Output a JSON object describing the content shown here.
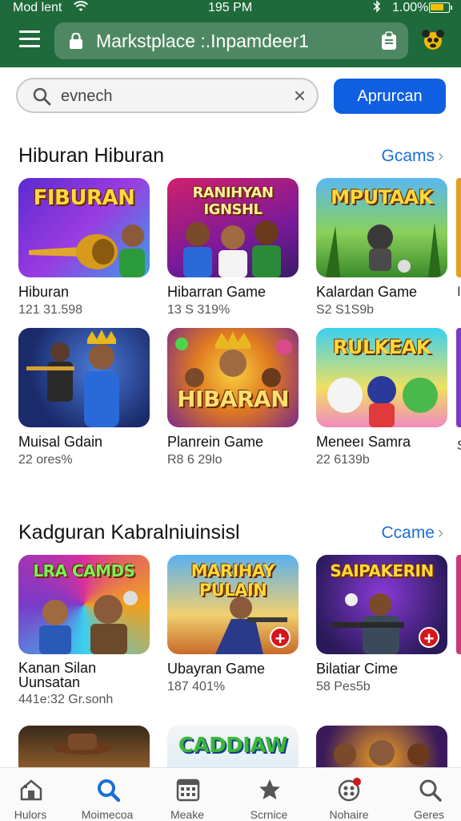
{
  "status_bar": {
    "carrier": "Mod lent",
    "time": "195 PM",
    "battery": "1.00%",
    "battery_level": 0.75
  },
  "browser": {
    "url": "Markstplace :.Inpamdeer1"
  },
  "search": {
    "value": "evnech",
    "button_label": "Aprurcan"
  },
  "sections": [
    {
      "title": "Hiburan Hiburan",
      "see_more": "Gcams",
      "rows": [
        [
          {
            "name": "Hiburan",
            "meta": "121 31.598",
            "art_title": "FIBURAN"
          },
          {
            "name": "Hibarran Game",
            "meta": "13 S 319%",
            "art_title": "RANIHYAN IGNSHL"
          },
          {
            "name": "Kalardan Game",
            "meta": "S2 S1S9b",
            "art_title": "MPUTAAK"
          }
        ],
        [
          {
            "name": "Muisal Gdain",
            "meta": "22 ores%",
            "art_title": ""
          },
          {
            "name": "Planrein Game",
            "meta": "R8 6 29lo",
            "art_title": "HIBARAN"
          },
          {
            "name": "Meneeı Samra",
            "meta": "22 6139b",
            "art_title": "RULKEAK"
          }
        ]
      ]
    },
    {
      "title": "Kadguran Kabralniuinsisl",
      "see_more": "Ccame",
      "rows": [
        [
          {
            "name": "Kanan Silan Uunsatan",
            "meta": "441e:32 Gr.sonh",
            "art_title": "LRA CAMDS"
          },
          {
            "name": "Ubayran Game",
            "meta": "187 401%",
            "art_title": "MARIHAY PULAIN"
          },
          {
            "name": "Bilatiar Cime",
            "meta": "58 Pes5b",
            "art_title": "SAIPAKERIN"
          }
        ],
        [
          {
            "name": "",
            "meta": "",
            "art_title": ""
          },
          {
            "name": "",
            "meta": "",
            "art_title": "CADDIAW"
          },
          {
            "name": "",
            "meta": "",
            "art_title": ""
          }
        ]
      ]
    }
  ],
  "bottom_nav": [
    {
      "label": "Hulors",
      "icon": "home-icon"
    },
    {
      "label": "Moimecoa",
      "icon": "search-icon"
    },
    {
      "label": "Meake",
      "icon": "calendar-icon"
    },
    {
      "label": "Scrnice",
      "icon": "star-icon"
    },
    {
      "label": "Nohaire",
      "icon": "notifications-icon"
    },
    {
      "label": "Geres",
      "icon": "search-icon"
    }
  ],
  "colors": {
    "top_bar": "#1e6a3a",
    "accent": "#0f5fe0",
    "link": "#1a6fd6",
    "badge": "#d4161b"
  }
}
